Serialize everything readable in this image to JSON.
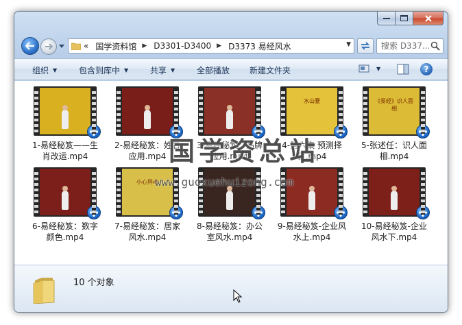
{
  "address": {
    "overflow_chevron": "«",
    "crumbs": [
      "国学资料馆",
      "D3301-D3400",
      "D3373 易经风水"
    ]
  },
  "search": {
    "placeholder": "搜索 D337..."
  },
  "toolbar": {
    "organize": "组织",
    "include_in_library": "包含到库中",
    "share": "共享",
    "play_all": "全部播放",
    "new_folder": "新建文件夹",
    "help": "?"
  },
  "files": [
    {
      "label": "1-易经秘笈——生肖改运.mp4",
      "bg": "#d9b020",
      "caption": ""
    },
    {
      "label": "2-易经秘笈：姓名应用.mp4",
      "bg": "#7a1e1a",
      "caption": ""
    },
    {
      "label": "3-易经秘笈：品牌应用.mp4",
      "bg": "#8a3026",
      "caption": ""
    },
    {
      "label": "4-第六集 预测择日.mp4",
      "bg": "#e4c33a",
      "caption": "水山蹇"
    },
    {
      "label": "5-张述任：识人面相.mp4",
      "bg": "#dcbc36",
      "caption": "《易经》识人面相"
    },
    {
      "label": "6-易经秘笈：数字颜色.mp4",
      "bg": "#7c1f1a",
      "caption": ""
    },
    {
      "label": "7-易经秘笈：居家风水.mp4",
      "bg": "#d8bf4a",
      "caption": "小心异动"
    },
    {
      "label": "8-易经秘笈：办公室风水.mp4",
      "bg": "#3a2620",
      "caption": ""
    },
    {
      "label": "9-易经秘笈-企业风水上.mp4",
      "bg": "#8b2b22",
      "caption": ""
    },
    {
      "label": "10-易经秘笈-企业风水下.mp4",
      "bg": "#7d2019",
      "caption": ""
    }
  ],
  "status": {
    "item_count": "10 个对象"
  },
  "watermark": {
    "text": "国学资总站",
    "url": "www.guoxuehuizong.com"
  }
}
